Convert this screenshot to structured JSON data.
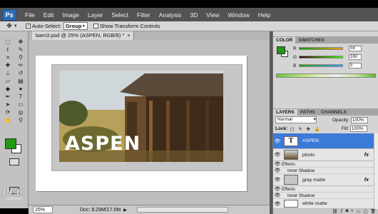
{
  "menubar": {
    "logo": "Ps",
    "items": [
      "File",
      "Edit",
      "Image",
      "Layer",
      "Select",
      "Filter",
      "Analysis",
      "3D",
      "View",
      "Window",
      "Help"
    ]
  },
  "options_bar": {
    "auto_select_label": "Auto-Select:",
    "auto_select_checked": true,
    "auto_select_value": "Group",
    "show_transform_label": "Show Transform Controls"
  },
  "document": {
    "tab_title": "barn3.psd @ 25% (ASPEN, RGB/8) *",
    "close_symbol": "×",
    "canvas_text": "ASPEN"
  },
  "status_bar": {
    "zoom": "25%",
    "doc_size": "Doc: 8.29M/17.0M"
  },
  "watermark": {
    "big": "PCC",
    "small": "Software"
  },
  "color_panel": {
    "tabs": [
      "COLOR",
      "SWATCHES"
    ],
    "fg_color": "#1f9a12",
    "channels": [
      {
        "ch": "R",
        "value": "54"
      },
      {
        "ch": "G",
        "value": "160"
      },
      {
        "ch": "B",
        "value": "5"
      }
    ]
  },
  "layers_panel": {
    "tabs": [
      "LAYERS",
      "PATHS",
      "CHANNELS"
    ],
    "blend_mode": "Normal",
    "opacity_label": "Opacity:",
    "opacity": "100%",
    "lock_label": "Lock:",
    "fill_label": "Fill:",
    "fill": "100%",
    "layers": [
      {
        "name": "ASPEN",
        "thumb": "T",
        "selected": true
      },
      {
        "name": "photo",
        "fx": "fx",
        "effects": [
          "Effects",
          "Inner Shadow"
        ]
      },
      {
        "name": "gray matte",
        "fx": "fx",
        "effects": [
          "Effects",
          "Inner Shadow"
        ]
      },
      {
        "name": "white matte"
      }
    ]
  }
}
